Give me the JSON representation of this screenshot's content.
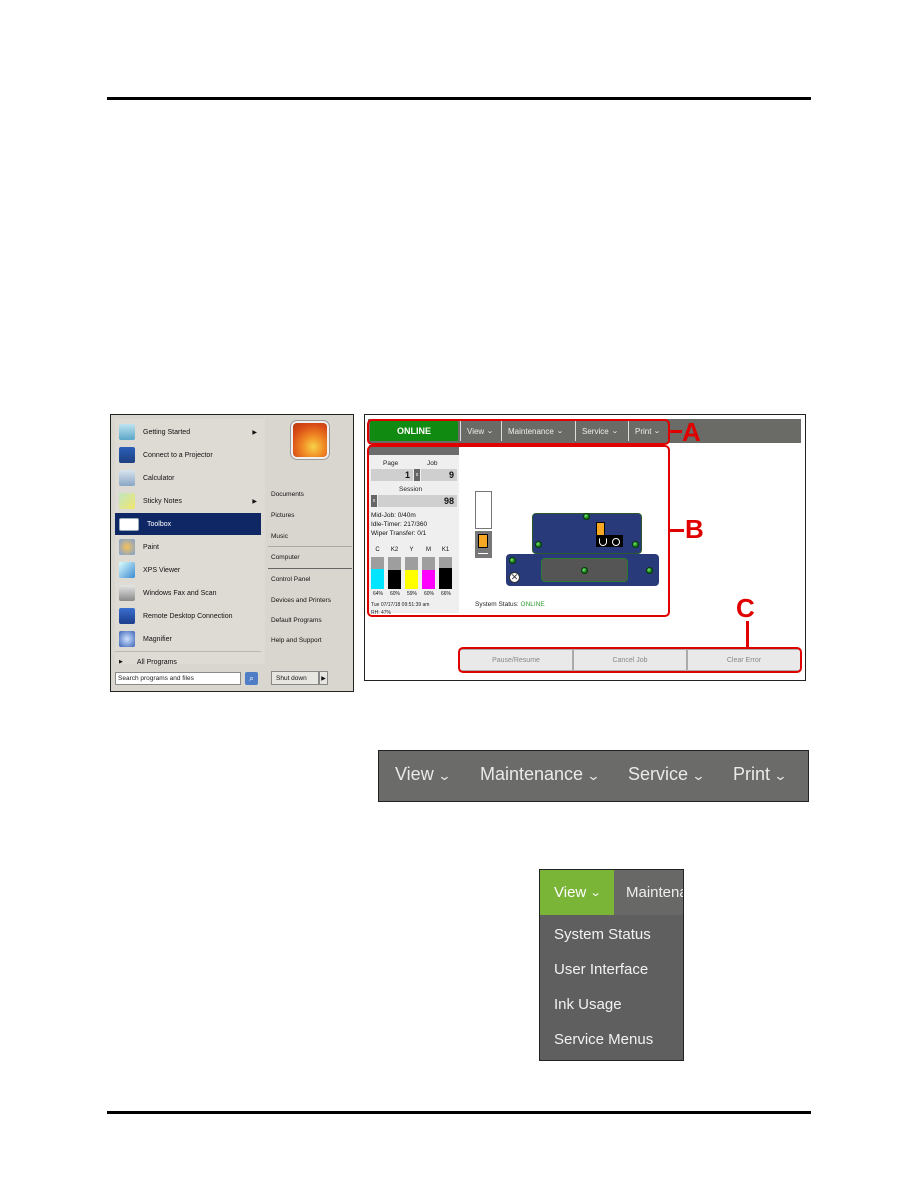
{
  "start_menu": {
    "left_items": [
      {
        "label": "Getting Started",
        "icon": "getting-started-icon",
        "submenu": true
      },
      {
        "label": "Connect to a Projector",
        "icon": "projector-icon",
        "submenu": false
      },
      {
        "label": "Calculator",
        "icon": "calculator-icon",
        "submenu": false
      },
      {
        "label": "Sticky Notes",
        "icon": "sticky-notes-icon",
        "submenu": true
      },
      {
        "label": "Toolbox",
        "icon": "toolbox-icon",
        "submenu": false,
        "selected": true
      },
      {
        "label": "Paint",
        "icon": "paint-icon",
        "submenu": false
      },
      {
        "label": "XPS Viewer",
        "icon": "xps-viewer-icon",
        "submenu": false
      },
      {
        "label": "Windows Fax and Scan",
        "icon": "fax-scan-icon",
        "submenu": false
      },
      {
        "label": "Remote Desktop Connection",
        "icon": "remote-desktop-icon",
        "submenu": false
      },
      {
        "label": "Magnifier",
        "icon": "magnifier-icon",
        "submenu": false
      }
    ],
    "all_programs": "All Programs",
    "search_placeholder": "Search programs and files",
    "right_items": [
      "Documents",
      "Pictures",
      "Music",
      "Computer",
      "Control Panel",
      "Devices and Printers",
      "Default Programs",
      "Help and Support"
    ],
    "shutdown_label": "Shut down"
  },
  "printer_ui": {
    "status_badge": "ONLINE",
    "menus": [
      "View",
      "Maintenance",
      "Service",
      "Print"
    ],
    "counters": {
      "page_label": "Page",
      "job_label": "Job",
      "page_value": "1",
      "job_value": "9",
      "session_label": "Session",
      "session_value": "98",
      "clear_glyph": "x"
    },
    "stats": [
      "Mid-Job: 0/40m",
      "Idle-Timer: 217/360",
      "Wiper Transfer: 0/1"
    ],
    "inks": [
      {
        "name": "C",
        "level_pct": 64,
        "label": "64%",
        "color": "#00e5ff"
      },
      {
        "name": "K2",
        "level_pct": 60,
        "label": "60%",
        "color": "#000000"
      },
      {
        "name": "Y",
        "level_pct": 59,
        "label": "59%",
        "color": "#ffff00"
      },
      {
        "name": "M",
        "level_pct": 60,
        "label": "60%",
        "color": "#ff00ff"
      },
      {
        "name": "K1",
        "level_pct": 66,
        "label": "66%",
        "color": "#000000"
      }
    ],
    "timestamp": "Tue 07/17/18 09:51:39 am",
    "humidity": "RH: 47%",
    "system_status_label": "System Status:",
    "system_status_value": "ONLINE",
    "actions": [
      "Pause/Resume",
      "Cancel Job",
      "Clear Error"
    ],
    "callouts": [
      "A",
      "B",
      "C"
    ]
  },
  "enlarged_nav": {
    "menus": [
      "View",
      "Maintenance",
      "Service",
      "Print"
    ]
  },
  "view_dropdown": {
    "active": "View",
    "neighbor": "Maintenance",
    "items": [
      "System Status",
      "User Interface",
      "Ink Usage",
      "Service Menus"
    ]
  },
  "colors": {
    "online_green": "#108a10",
    "menu_bar_gray": "#6a6a66",
    "active_menu_green": "#7ab538",
    "callout_red": "#e00000",
    "start_selected": "#0f2865"
  }
}
